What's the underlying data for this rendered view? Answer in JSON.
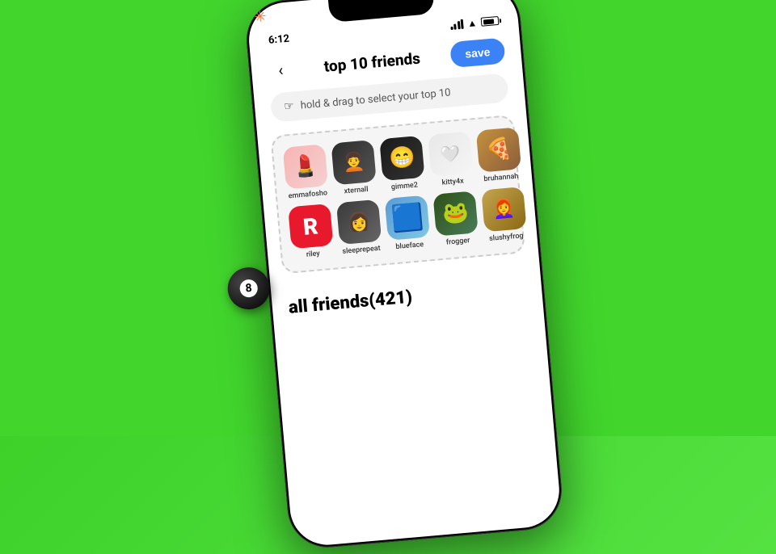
{
  "background": {
    "color": "#42d62d"
  },
  "decorations": {
    "eight_ball_label": "8",
    "star_label": "✳"
  },
  "status_bar": {
    "time": "6:12",
    "signal": "signal",
    "wifi": "wifi",
    "battery": "battery"
  },
  "header": {
    "back_label": "‹",
    "title": "top 10 friends",
    "save_label": "save"
  },
  "hint_bar": {
    "icon": "☞",
    "text": "hold & drag to select your top 10"
  },
  "top_friends": {
    "row1": [
      {
        "name": "emmafosho",
        "emoji": "💄",
        "bg": "#f5c0c0"
      },
      {
        "name": "xternall",
        "emoji": "🧑‍🦱",
        "bg": "#2c2c2c"
      },
      {
        "name": "gimme2",
        "emoji": "😁",
        "bg": "#1a1a1a"
      },
      {
        "name": "kitty4x",
        "emoji": "🤍",
        "bg": "#e0e0e0"
      },
      {
        "name": "bruhannah",
        "emoji": "🍕",
        "bg": "#8b5e3c"
      }
    ],
    "row2": [
      {
        "name": "riley",
        "emoji": "R",
        "bg": "#e8192c"
      },
      {
        "name": "sleeprepeat",
        "emoji": "👧",
        "bg": "#3a3a3a"
      },
      {
        "name": "blueface",
        "emoji": "🟦",
        "bg": "#5b9bd5"
      },
      {
        "name": "frogger",
        "emoji": "🐸",
        "bg": "#2d5016"
      },
      {
        "name": "slushyfrog",
        "emoji": "👩",
        "bg": "#c4a44e"
      }
    ]
  },
  "all_friends": {
    "label": "all friends",
    "count": "(421)"
  }
}
